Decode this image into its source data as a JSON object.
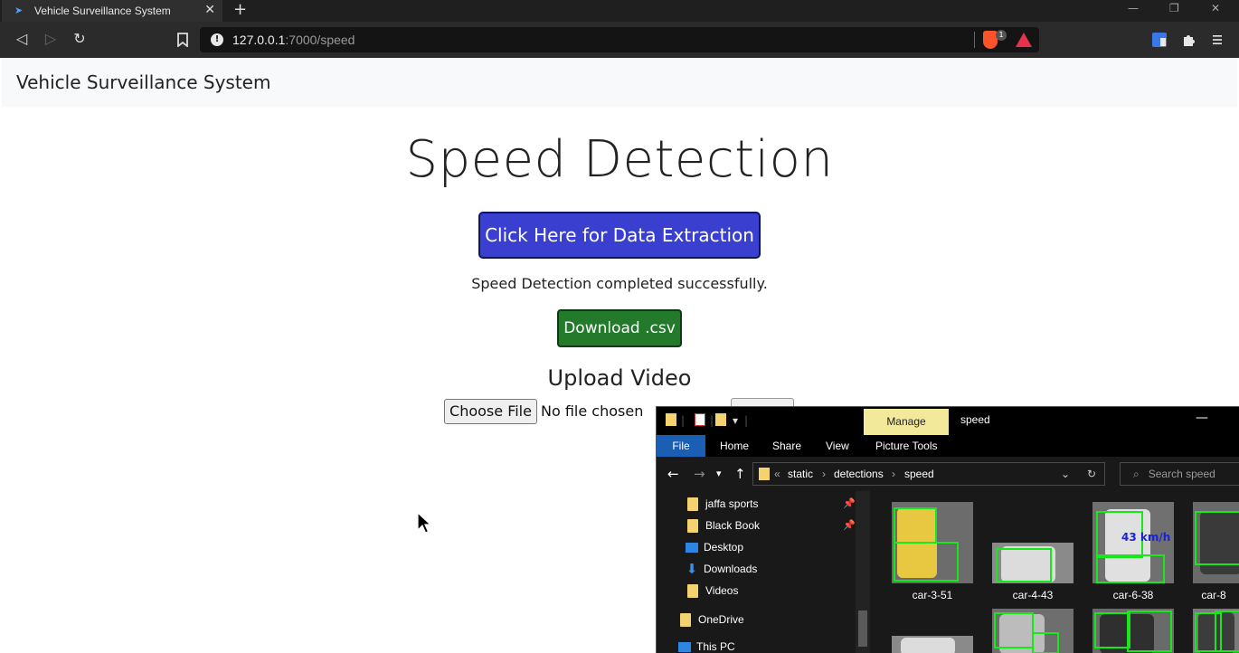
{
  "browser": {
    "tab_title": "Vehicle Surveillance System",
    "url_host": "127.0.0.1",
    "url_path": ":7000/speed",
    "extension_badge": "1"
  },
  "page": {
    "brand": "Vehicle Surveillance System",
    "title": "Speed Detection",
    "extract_button": "Click Here for Data Extraction",
    "status_message": "Speed Detection completed successfully.",
    "download_button": "Download .csv",
    "upload_heading": "Upload Video",
    "choose_file_button": "Choose File",
    "file_status": "No file chosen"
  },
  "explorer": {
    "manage_tab": "Manage",
    "window_title": "speed",
    "ribbon_tabs": [
      "File",
      "Home",
      "Share",
      "View",
      "Picture Tools"
    ],
    "breadcrumb": [
      "static",
      "detections",
      "speed"
    ],
    "search_placeholder": "Search speed",
    "nav_items": [
      "jaffa sports",
      "Black Book",
      "Desktop",
      "Downloads",
      "Videos",
      "OneDrive",
      "This PC"
    ],
    "files": [
      "car-3-51",
      "car-4-43",
      "car-6-38",
      "car-8"
    ],
    "speed_overlay": "43 km/h"
  },
  "colors": {
    "extract_button": "#3b3fcf",
    "download_button": "#227a2a",
    "detection_box": "#16e81c",
    "manage_tab": "#f2e99b",
    "file_tab": "#1a5fb4"
  }
}
